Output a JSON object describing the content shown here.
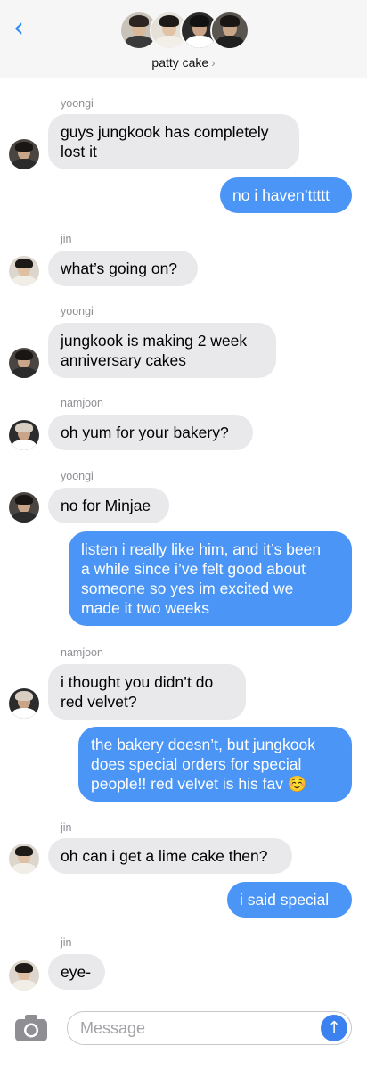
{
  "header": {
    "back_icon": "chevron-left-icon",
    "group_name": "patty cake",
    "group_chevron": "›"
  },
  "colors": {
    "outgoing": "#4a95f5",
    "incoming": "#e9e9eb",
    "accent": "#2f8cf6"
  },
  "messages": [
    {
      "sender": "yoongi",
      "text": "guys jungkook has completely\nlost it"
    },
    {
      "text": "no i haven’ttttt"
    },
    {
      "sender": "jin",
      "text": "what’s going on?"
    },
    {
      "sender": "yoongi",
      "text": "jungkook is making 2 week\nanniversary cakes"
    },
    {
      "sender": "namjoon",
      "text": "oh yum for your bakery?"
    },
    {
      "sender": "yoongi",
      "text": "no for Minjae"
    },
    {
      "text": "listen i really like him, and it’s been\na while since i’ve felt good about\nsomeone so yes im excited we\nmade it two weeks"
    },
    {
      "sender": "namjoon",
      "text": "i thought you didn’t do\nred velvet?"
    },
    {
      "text": "the bakery doesn’t, but jungkook\ndoes special orders for special\npeople!! red velvet is his fav ☺️"
    },
    {
      "sender": "jin",
      "text": "oh can i get a lime cake then?"
    },
    {
      "text": "i said special"
    },
    {
      "sender": "jin",
      "text": "eye-"
    }
  ],
  "composer": {
    "placeholder": "Message",
    "send_icon": "↑"
  }
}
